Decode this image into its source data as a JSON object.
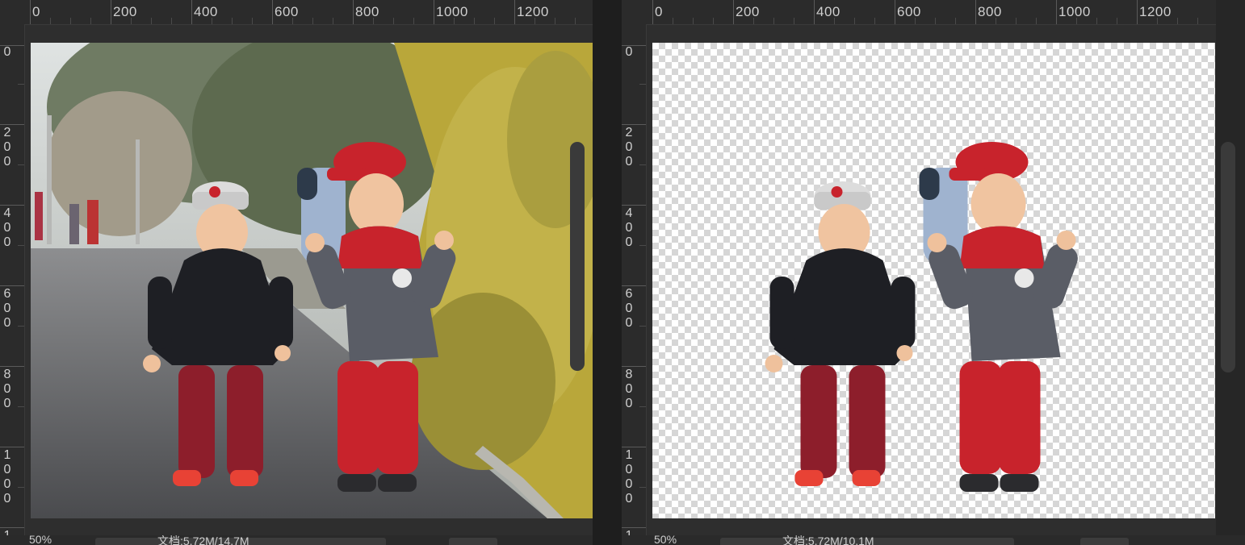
{
  "left_panel": {
    "ruler_top_labels": [
      "0",
      "200",
      "400",
      "600",
      "800",
      "1000",
      "1200"
    ],
    "ruler_left_labels": [
      "0",
      "2\n0\n0",
      "4\n0\n0",
      "6\n0\n0",
      "8\n0\n0",
      "1\n0\n0\n0",
      "1"
    ],
    "zoom_text": "50%",
    "doc_info": "文档:5.72M/14.7M"
  },
  "right_panel": {
    "ruler_top_labels": [
      "0",
      "200",
      "400",
      "600",
      "800",
      "1000",
      "1200"
    ],
    "ruler_left_labels": [
      "0",
      "2\n0\n0",
      "4\n0\n0",
      "6\n0\n0",
      "8\n0\n0",
      "1\n0\n0\n0",
      "1"
    ],
    "zoom_text": "50%",
    "doc_info": "文档:5.72M/10.1M"
  },
  "colors": {
    "accent_red": "#c8232c",
    "jacket_dark": "#1e1f24",
    "jacket_grey": "#5a5d66",
    "asphalt": "#5c5d60",
    "foliage_yellow": "#b9a73a",
    "checker_light": "#ffffff",
    "checker_dark": "#d6d6d6"
  }
}
